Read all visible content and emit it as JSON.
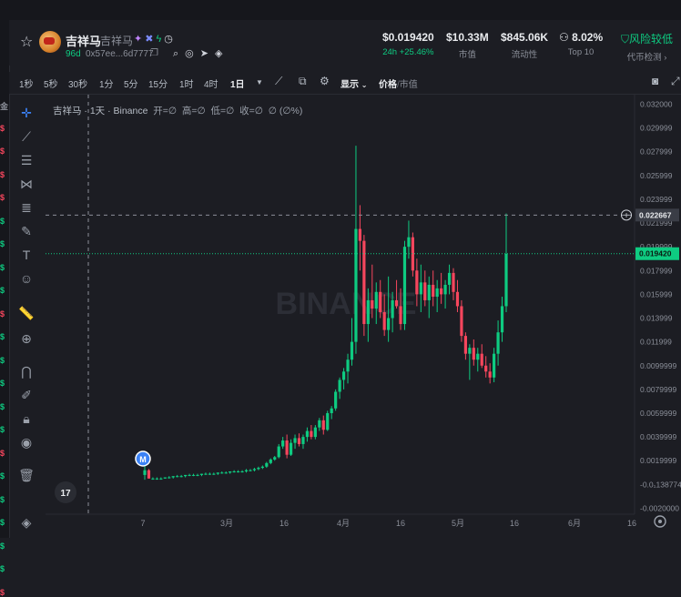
{
  "left_strip": {
    "items": [
      {
        "label": "金",
        "color": "#8b8f99"
      },
      {
        "label": "$",
        "color": "#f6465d"
      },
      {
        "label": "$",
        "color": "#f6465d"
      },
      {
        "label": "$",
        "color": "#f6465d"
      },
      {
        "label": "$",
        "color": "#f6465d"
      },
      {
        "label": "$",
        "color": "#0ecb81"
      },
      {
        "label": "$",
        "color": "#0ecb81"
      },
      {
        "label": "$",
        "color": "#0ecb81"
      },
      {
        "label": "$",
        "color": "#0ecb81"
      },
      {
        "label": "$",
        "color": "#f6465d"
      },
      {
        "label": "$",
        "color": "#0ecb81"
      },
      {
        "label": "$",
        "color": "#0ecb81"
      },
      {
        "label": "$",
        "color": "#0ecb81"
      },
      {
        "label": "$",
        "color": "#0ecb81"
      },
      {
        "label": "$",
        "color": "#0ecb81"
      },
      {
        "label": "$",
        "color": "#f6465d"
      },
      {
        "label": "$",
        "color": "#0ecb81"
      },
      {
        "label": "$",
        "color": "#0ecb81"
      },
      {
        "label": "$",
        "color": "#0ecb81"
      },
      {
        "label": "$",
        "color": "#0ecb81"
      },
      {
        "label": "$",
        "color": "#0ecb81"
      },
      {
        "label": "$",
        "color": "#f6465d"
      }
    ]
  },
  "token": {
    "name": "吉祥马",
    "symbol": "吉祥马",
    "age": "96d",
    "address": "0x57ee...6d7777",
    "badge_icons": [
      "sparkle-icon",
      "cross-icon",
      "flash-icon",
      "timer-icon"
    ],
    "social_icons": [
      "search-icon",
      "website-icon",
      "telegram-icon",
      "binance-icon"
    ]
  },
  "stats": [
    {
      "value": "$0.019420",
      "label": "24h +25.46%",
      "key": "price"
    },
    {
      "value": "$10.33M",
      "label": "市值",
      "key": "mcap"
    },
    {
      "value": "$845.06K",
      "label": "流动性",
      "key": "liquidity"
    },
    {
      "value": "8.02%",
      "label": "Top 10",
      "key": "top10"
    },
    {
      "value": "风险较低",
      "label": "代币检测 ›",
      "key": "risk"
    }
  ],
  "toolbar": {
    "intervals": [
      "1秒",
      "5秒",
      "30秒",
      "1分",
      "5分",
      "15分",
      "1时",
      "4时",
      "1日"
    ],
    "active_interval": "1日",
    "display_label": "显示",
    "price_label": "价格",
    "mcap_label": "市值",
    "separator": "/"
  },
  "legend": {
    "name": "吉祥马 · 1天 · Binance",
    "open": "开=∅",
    "high": "高=∅",
    "low": "低=∅",
    "close": "收=∅",
    "change": "∅ (∅%)"
  },
  "watermark": "BINANCE",
  "marker_label": "M",
  "chart_data": {
    "type": "candlestick",
    "y_ticks": [
      "0.032000",
      "0.029999",
      "0.027999",
      "0.025999",
      "0.023999",
      "0.021999",
      "0.019999",
      "0.017999",
      "0.015999",
      "0.013999",
      "0.011999",
      "0.0099999",
      "0.0079999",
      "0.0059999",
      "0.0039999",
      "0.0019999",
      "-0.0₁138774",
      "-0.0020000"
    ],
    "x_ticks": [
      "7",
      "3月",
      "16",
      "4月",
      "16",
      "5月",
      "16",
      "6月",
      "16"
    ],
    "crosshair_price": "0.022667",
    "last_price": "0.019420",
    "ylim": [
      -0.0025,
      0.0328
    ],
    "up_color": "#0ecb81",
    "down_color": "#f6465d",
    "candles": [
      [
        0.0008,
        0.0016,
        0.0004,
        0.0012
      ],
      [
        0.0012,
        0.0013,
        0.0005,
        0.0005
      ],
      [
        0.0005,
        0.0006,
        0.0004,
        0.0005
      ],
      [
        0.0005,
        0.0006,
        0.0004,
        0.0005
      ],
      [
        0.0005,
        0.0006,
        0.0004,
        0.0005
      ],
      [
        0.0005,
        0.0006,
        0.0005,
        0.0006
      ],
      [
        0.0006,
        0.0007,
        0.0005,
        0.0006
      ],
      [
        0.0006,
        0.0007,
        0.0005,
        0.0007
      ],
      [
        0.0007,
        0.0008,
        0.0006,
        0.0007
      ],
      [
        0.0007,
        0.0008,
        0.0006,
        0.0007
      ],
      [
        0.0007,
        0.0008,
        0.0006,
        0.0008
      ],
      [
        0.0008,
        0.0009,
        0.0007,
        0.0008
      ],
      [
        0.0008,
        0.0009,
        0.0007,
        0.0008
      ],
      [
        0.0008,
        0.0009,
        0.0007,
        0.0008
      ],
      [
        0.0008,
        0.0009,
        0.0007,
        0.0009
      ],
      [
        0.0009,
        0.001,
        0.0008,
        0.0009
      ],
      [
        0.0009,
        0.001,
        0.0008,
        0.0009
      ],
      [
        0.0009,
        0.001,
        0.0008,
        0.0009
      ],
      [
        0.0009,
        0.001,
        0.0008,
        0.001
      ],
      [
        0.001,
        0.0011,
        0.0009,
        0.001
      ],
      [
        0.001,
        0.0011,
        0.0009,
        0.001
      ],
      [
        0.001,
        0.0011,
        0.0009,
        0.0011
      ],
      [
        0.0011,
        0.0012,
        0.001,
        0.0011
      ],
      [
        0.0011,
        0.0012,
        0.001,
        0.0011
      ],
      [
        0.0011,
        0.0012,
        0.001,
        0.0011
      ],
      [
        0.0011,
        0.0013,
        0.001,
        0.0012
      ],
      [
        0.0012,
        0.0013,
        0.0011,
        0.0012
      ],
      [
        0.0012,
        0.0014,
        0.0011,
        0.0013
      ],
      [
        0.0013,
        0.0015,
        0.0012,
        0.0014
      ],
      [
        0.0014,
        0.0016,
        0.0013,
        0.0015
      ],
      [
        0.0015,
        0.0019,
        0.0014,
        0.0018
      ],
      [
        0.0018,
        0.0022,
        0.0017,
        0.0021
      ],
      [
        0.0021,
        0.0024,
        0.002,
        0.0023
      ],
      [
        0.0023,
        0.0034,
        0.0022,
        0.0032
      ],
      [
        0.0032,
        0.004,
        0.003,
        0.0037
      ],
      [
        0.0037,
        0.0042,
        0.0022,
        0.0025
      ],
      [
        0.0025,
        0.0038,
        0.0024,
        0.0035
      ],
      [
        0.0035,
        0.0042,
        0.003,
        0.0039
      ],
      [
        0.0039,
        0.0043,
        0.0032,
        0.0034
      ],
      [
        0.0034,
        0.0042,
        0.003,
        0.004
      ],
      [
        0.004,
        0.0048,
        0.0036,
        0.0045
      ],
      [
        0.0045,
        0.005,
        0.0038,
        0.004
      ],
      [
        0.004,
        0.005,
        0.0038,
        0.0048
      ],
      [
        0.0048,
        0.0056,
        0.0045,
        0.0054
      ],
      [
        0.0054,
        0.0058,
        0.0042,
        0.0046
      ],
      [
        0.0046,
        0.0062,
        0.0045,
        0.006
      ],
      [
        0.006,
        0.0066,
        0.0055,
        0.0064
      ],
      [
        0.0064,
        0.008,
        0.0062,
        0.0078
      ],
      [
        0.0078,
        0.009,
        0.0072,
        0.0088
      ],
      [
        0.0088,
        0.0098,
        0.008,
        0.0095
      ],
      [
        0.0095,
        0.011,
        0.0085,
        0.0105
      ],
      [
        0.0105,
        0.014,
        0.01,
        0.012
      ],
      [
        0.012,
        0.0285,
        0.011,
        0.0215
      ],
      [
        0.0215,
        0.0235,
        0.018,
        0.0205
      ],
      [
        0.0205,
        0.021,
        0.0125,
        0.0135
      ],
      [
        0.0135,
        0.0165,
        0.012,
        0.0155
      ],
      [
        0.0155,
        0.0185,
        0.014,
        0.0148
      ],
      [
        0.0148,
        0.017,
        0.0135,
        0.0162
      ],
      [
        0.0162,
        0.0172,
        0.014,
        0.0145
      ],
      [
        0.0145,
        0.016,
        0.0125,
        0.013
      ],
      [
        0.013,
        0.0175,
        0.012,
        0.014
      ],
      [
        0.014,
        0.0162,
        0.0128,
        0.0155
      ],
      [
        0.0155,
        0.0172,
        0.0148,
        0.015
      ],
      [
        0.015,
        0.0165,
        0.013,
        0.0135
      ],
      [
        0.0135,
        0.0205,
        0.013,
        0.02
      ],
      [
        0.02,
        0.0222,
        0.019,
        0.0208
      ],
      [
        0.0208,
        0.0212,
        0.0175,
        0.018
      ],
      [
        0.018,
        0.019,
        0.015,
        0.016
      ],
      [
        0.016,
        0.0185,
        0.0145,
        0.017
      ],
      [
        0.017,
        0.018,
        0.015,
        0.0155
      ],
      [
        0.0155,
        0.0175,
        0.014,
        0.0168
      ],
      [
        0.0168,
        0.018,
        0.015,
        0.0158
      ],
      [
        0.0158,
        0.0172,
        0.0145,
        0.0165
      ],
      [
        0.0165,
        0.0178,
        0.0152,
        0.016
      ],
      [
        0.016,
        0.0172,
        0.0148,
        0.0168
      ],
      [
        0.0168,
        0.0185,
        0.016,
        0.0178
      ],
      [
        0.0178,
        0.0182,
        0.0155,
        0.0162
      ],
      [
        0.0162,
        0.0172,
        0.0145,
        0.015
      ],
      [
        0.015,
        0.0155,
        0.012,
        0.0125
      ],
      [
        0.0125,
        0.0128,
        0.0105,
        0.011
      ],
      [
        0.011,
        0.0118,
        0.0088,
        0.0115
      ],
      [
        0.0115,
        0.0122,
        0.01,
        0.0105
      ],
      [
        0.0105,
        0.0115,
        0.0095,
        0.011
      ],
      [
        0.011,
        0.0118,
        0.0098,
        0.01
      ],
      [
        0.01,
        0.0108,
        0.009,
        0.0095
      ],
      [
        0.0095,
        0.0102,
        0.0085,
        0.009
      ],
      [
        0.009,
        0.0115,
        0.0086,
        0.011
      ],
      [
        0.011,
        0.0138,
        0.01,
        0.0128
      ],
      [
        0.0128,
        0.0158,
        0.012,
        0.015
      ],
      [
        0.015,
        0.0228,
        0.0145,
        0.0194
      ]
    ]
  }
}
